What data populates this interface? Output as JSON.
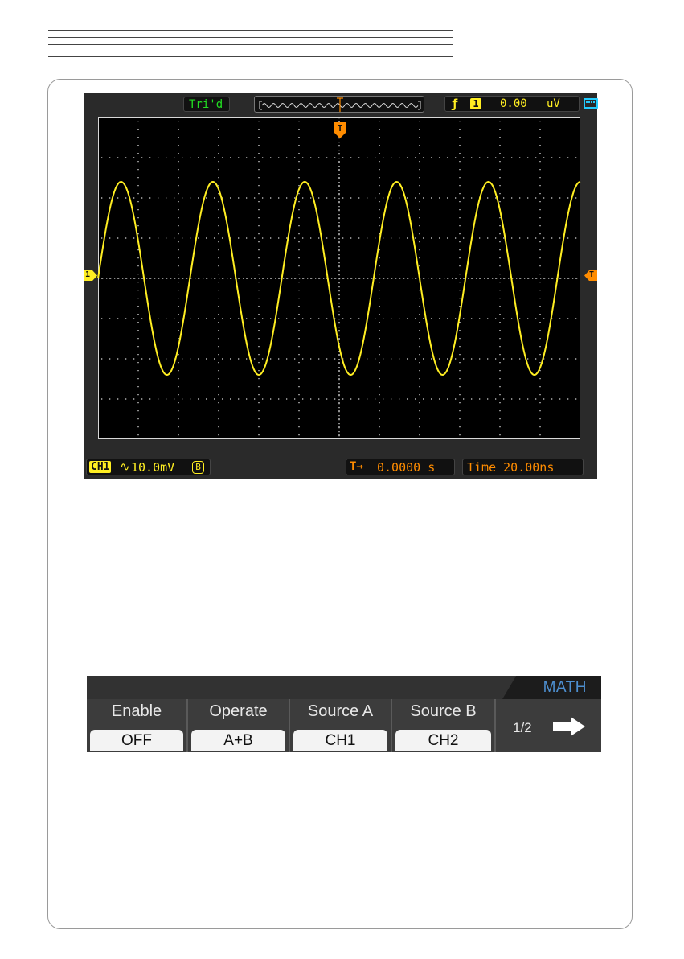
{
  "scope": {
    "trigger_status": "Tri'd",
    "trigger_info": {
      "edge_symbol": "ƒ",
      "channel": "1",
      "level": "0.00",
      "unit": "uV"
    },
    "channel_marker": "1",
    "trigger_marker": "T",
    "time_marker": "T",
    "ch1": {
      "label": "CH1",
      "coupling_symbol": "∿",
      "scale": "10.0mV",
      "bw_badge": "B"
    },
    "trigger_position": {
      "symbol": "T→",
      "value": "0.0000 s"
    },
    "timebase": "Time 20.00ns",
    "colors": {
      "trace": "#ffee22",
      "grid": "#d8d8d8",
      "accent_orange": "#ff8c00",
      "status_green": "#22dd22",
      "battery": "#22ccff"
    },
    "waveform": {
      "cycles_visible": 5.25,
      "amplitude_divisions": 2.4,
      "start_phase": "zero-crossing rising"
    }
  },
  "menu": {
    "title": "MATH",
    "softkeys": [
      {
        "label": "Enable",
        "value": "OFF"
      },
      {
        "label": "Operate",
        "value": "A+B"
      },
      {
        "label": "Source A",
        "value": "CH1"
      },
      {
        "label": "Source B",
        "value": "CH2"
      }
    ],
    "page": "1/2",
    "next_icon": "right-arrow-icon"
  }
}
